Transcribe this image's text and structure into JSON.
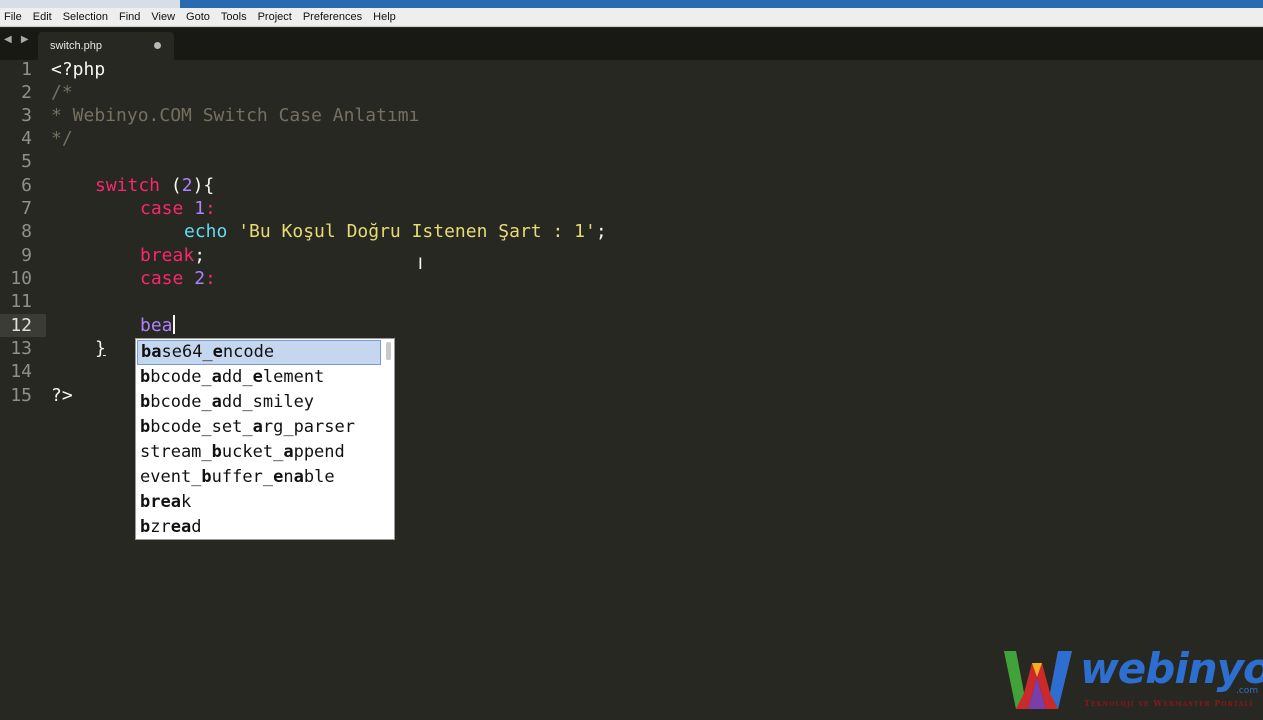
{
  "menu": [
    "File",
    "Edit",
    "Selection",
    "Find",
    "View",
    "Goto",
    "Tools",
    "Project",
    "Preferences",
    "Help"
  ],
  "tab": {
    "name": "switch.php"
  },
  "nav_arrows": "◀ ▶",
  "line_numbers": [
    "1",
    "2",
    "3",
    "4",
    "5",
    "6",
    "7",
    "8",
    "9",
    "10",
    "11",
    "12",
    "13",
    "14",
    "15"
  ],
  "current_line": "12",
  "code": {
    "l1": "<?php",
    "l2": "/*",
    "l3": "* Webinyo.COM Switch Case Anlatımı",
    "l4": "*/",
    "l6_kw": "switch",
    "l6_open": " (",
    "l6_num": "2",
    "l6_close": "){",
    "l7_kw": "case",
    "l7_num": " 1",
    "l7_colon": ":",
    "l8_fn": "echo",
    "l8_str": " 'Bu Koşul Doğru Istenen Şart : 1'",
    "l8_end": ";",
    "l9_kw": "break",
    "l9_end": ";",
    "l10_kw": "case",
    "l10_num": " 2",
    "l10_colon": ":",
    "l12_typed": "bea",
    "l13": "}",
    "l15": "?>"
  },
  "autocomplete": [
    {
      "b1": "ba",
      "t1": "se64_",
      "b2": "e",
      "t2": "ncode"
    },
    {
      "b1": "b",
      "t1": "bcode_",
      "b2": "a",
      "t2": "dd_",
      "b3": "e",
      "t3": "lement"
    },
    {
      "b1": "b",
      "t1": "bcode_",
      "b2": "a",
      "t2": "dd_smiley"
    },
    {
      "b1": "b",
      "t1": "bcode_set_",
      "b2": "a",
      "t2": "rg_parser"
    },
    {
      "t0": "stream_",
      "b1": "b",
      "t1": "ucket_",
      "b2": "a",
      "t2": "ppend"
    },
    {
      "t0": "event_",
      "b1": "b",
      "t1": "uffer_",
      "b2": "e",
      "t2": "n",
      "b3": "a",
      "t3": "ble"
    },
    {
      "b1": "bre",
      "b2": "a",
      "t2": "k"
    },
    {
      "b1": "b",
      "t1": "zr",
      "b2": "ea",
      "t2": "d"
    }
  ],
  "logo": {
    "word": "webinyo",
    "dotcom": ".com",
    "tagline": "Teknoloji ve Webmaster Portalı"
  },
  "colors": {
    "editor_bg": "#272822",
    "keyword": "#f92672",
    "number": "#ae81ff",
    "string": "#e6db74",
    "function": "#66d9ef",
    "comment": "#75715e",
    "selection": "#c5d6ef",
    "logo_blue": "#2d6fd0"
  }
}
